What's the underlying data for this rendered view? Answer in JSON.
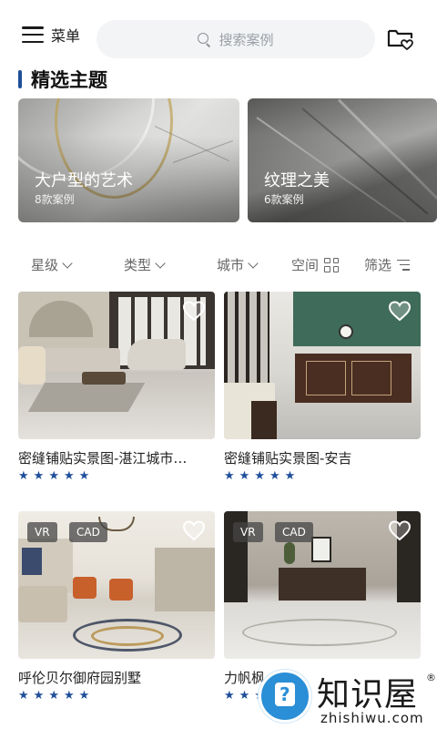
{
  "header": {
    "menu_label": "菜单",
    "search_placeholder": "搜索案例"
  },
  "section": {
    "title": "精选主题"
  },
  "themes": [
    {
      "title": "大户型的艺术",
      "count": "8款案例"
    },
    {
      "title": "纹理之美",
      "count": "6款案例"
    }
  ],
  "filters": {
    "star": "星级",
    "type": "类型",
    "city": "城市",
    "space": "空间",
    "filter": "筛选"
  },
  "cases": [
    {
      "name": "密缝铺贴实景图-湛江城市…",
      "stars": 5,
      "tags": []
    },
    {
      "name": "密缝铺贴实景图-安吉",
      "stars": 5,
      "tags": []
    },
    {
      "name": "呼伦贝尔御府园别墅",
      "stars": 5,
      "tags": [
        "VR",
        "CAD"
      ]
    },
    {
      "name": "力帆枫",
      "stars": 3,
      "tags": [
        "VR",
        "CAD"
      ]
    }
  ],
  "colors": {
    "accent": "#1f4f9a",
    "search_bg": "#f3f4f6"
  },
  "watermark": {
    "name": "知识屋",
    "url": "zhishiwu.com",
    "reg": "®"
  }
}
